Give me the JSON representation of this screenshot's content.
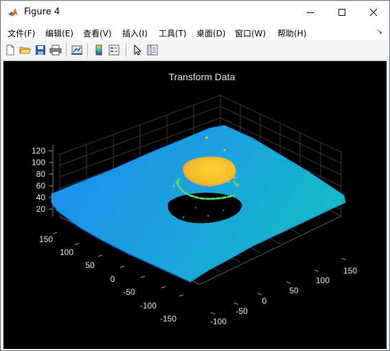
{
  "window": {
    "title": "Figure 4"
  },
  "menu": {
    "items": [
      "文件(F)",
      "编辑(E)",
      "查看(V)",
      "插入(I)",
      "工具(T)",
      "桌面(D)",
      "窗口(W)",
      "帮助(H)"
    ],
    "overflow": "↘"
  },
  "toolbar": {
    "buttons": [
      "new-figure",
      "open-file",
      "save",
      "print",
      "link-plot",
      "insert-colorbar",
      "insert-legend",
      "edit-plot",
      "property-inspector"
    ]
  },
  "axes": {
    "title": "Transform Data",
    "z_ticks": [
      "120",
      "100",
      "80",
      "60",
      "40",
      "20"
    ],
    "y_ticks": [
      "150",
      "100",
      "50",
      "0",
      "-50",
      "-100",
      "-150"
    ],
    "x_ticks": [
      "150",
      "100",
      "50",
      "0",
      "-50",
      "-100"
    ]
  },
  "colors": {
    "axes_bg": "#000000",
    "grid": "#3a3a3a",
    "tick_text": "#e6e6e6",
    "title_text": "#e6e6e6",
    "surface_low": "#1f8ff0",
    "surface_high": "#16b7cc",
    "object_top": "#fbc028",
    "object_ring": "#5bd263"
  }
}
